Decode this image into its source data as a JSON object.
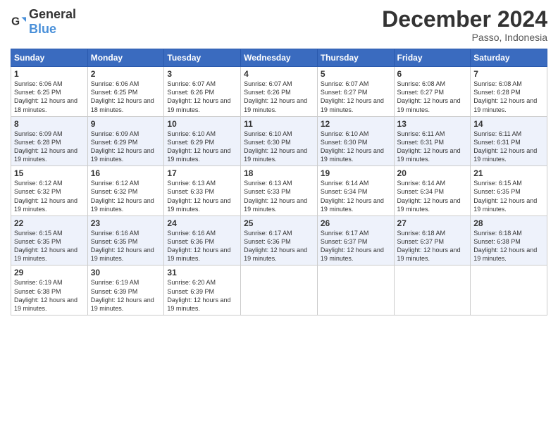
{
  "logo": {
    "general": "General",
    "blue": "Blue"
  },
  "header": {
    "title": "December 2024",
    "subtitle": "Passo, Indonesia"
  },
  "weekdays": [
    "Sunday",
    "Monday",
    "Tuesday",
    "Wednesday",
    "Thursday",
    "Friday",
    "Saturday"
  ],
  "weeks": [
    [
      {
        "day": "1",
        "sunrise": "6:06 AM",
        "sunset": "6:25 PM",
        "daylight": "12 hours and 18 minutes."
      },
      {
        "day": "2",
        "sunrise": "6:06 AM",
        "sunset": "6:25 PM",
        "daylight": "12 hours and 18 minutes."
      },
      {
        "day": "3",
        "sunrise": "6:07 AM",
        "sunset": "6:26 PM",
        "daylight": "12 hours and 19 minutes."
      },
      {
        "day": "4",
        "sunrise": "6:07 AM",
        "sunset": "6:26 PM",
        "daylight": "12 hours and 19 minutes."
      },
      {
        "day": "5",
        "sunrise": "6:07 AM",
        "sunset": "6:27 PM",
        "daylight": "12 hours and 19 minutes."
      },
      {
        "day": "6",
        "sunrise": "6:08 AM",
        "sunset": "6:27 PM",
        "daylight": "12 hours and 19 minutes."
      },
      {
        "day": "7",
        "sunrise": "6:08 AM",
        "sunset": "6:28 PM",
        "daylight": "12 hours and 19 minutes."
      }
    ],
    [
      {
        "day": "8",
        "sunrise": "6:09 AM",
        "sunset": "6:28 PM",
        "daylight": "12 hours and 19 minutes."
      },
      {
        "day": "9",
        "sunrise": "6:09 AM",
        "sunset": "6:29 PM",
        "daylight": "12 hours and 19 minutes."
      },
      {
        "day": "10",
        "sunrise": "6:10 AM",
        "sunset": "6:29 PM",
        "daylight": "12 hours and 19 minutes."
      },
      {
        "day": "11",
        "sunrise": "6:10 AM",
        "sunset": "6:30 PM",
        "daylight": "12 hours and 19 minutes."
      },
      {
        "day": "12",
        "sunrise": "6:10 AM",
        "sunset": "6:30 PM",
        "daylight": "12 hours and 19 minutes."
      },
      {
        "day": "13",
        "sunrise": "6:11 AM",
        "sunset": "6:31 PM",
        "daylight": "12 hours and 19 minutes."
      },
      {
        "day": "14",
        "sunrise": "6:11 AM",
        "sunset": "6:31 PM",
        "daylight": "12 hours and 19 minutes."
      }
    ],
    [
      {
        "day": "15",
        "sunrise": "6:12 AM",
        "sunset": "6:32 PM",
        "daylight": "12 hours and 19 minutes."
      },
      {
        "day": "16",
        "sunrise": "6:12 AM",
        "sunset": "6:32 PM",
        "daylight": "12 hours and 19 minutes."
      },
      {
        "day": "17",
        "sunrise": "6:13 AM",
        "sunset": "6:33 PM",
        "daylight": "12 hours and 19 minutes."
      },
      {
        "day": "18",
        "sunrise": "6:13 AM",
        "sunset": "6:33 PM",
        "daylight": "12 hours and 19 minutes."
      },
      {
        "day": "19",
        "sunrise": "6:14 AM",
        "sunset": "6:34 PM",
        "daylight": "12 hours and 19 minutes."
      },
      {
        "day": "20",
        "sunrise": "6:14 AM",
        "sunset": "6:34 PM",
        "daylight": "12 hours and 19 minutes."
      },
      {
        "day": "21",
        "sunrise": "6:15 AM",
        "sunset": "6:35 PM",
        "daylight": "12 hours and 19 minutes."
      }
    ],
    [
      {
        "day": "22",
        "sunrise": "6:15 AM",
        "sunset": "6:35 PM",
        "daylight": "12 hours and 19 minutes."
      },
      {
        "day": "23",
        "sunrise": "6:16 AM",
        "sunset": "6:35 PM",
        "daylight": "12 hours and 19 minutes."
      },
      {
        "day": "24",
        "sunrise": "6:16 AM",
        "sunset": "6:36 PM",
        "daylight": "12 hours and 19 minutes."
      },
      {
        "day": "25",
        "sunrise": "6:17 AM",
        "sunset": "6:36 PM",
        "daylight": "12 hours and 19 minutes."
      },
      {
        "day": "26",
        "sunrise": "6:17 AM",
        "sunset": "6:37 PM",
        "daylight": "12 hours and 19 minutes."
      },
      {
        "day": "27",
        "sunrise": "6:18 AM",
        "sunset": "6:37 PM",
        "daylight": "12 hours and 19 minutes."
      },
      {
        "day": "28",
        "sunrise": "6:18 AM",
        "sunset": "6:38 PM",
        "daylight": "12 hours and 19 minutes."
      }
    ],
    [
      {
        "day": "29",
        "sunrise": "6:19 AM",
        "sunset": "6:38 PM",
        "daylight": "12 hours and 19 minutes."
      },
      {
        "day": "30",
        "sunrise": "6:19 AM",
        "sunset": "6:39 PM",
        "daylight": "12 hours and 19 minutes."
      },
      {
        "day": "31",
        "sunrise": "6:20 AM",
        "sunset": "6:39 PM",
        "daylight": "12 hours and 19 minutes."
      },
      null,
      null,
      null,
      null
    ]
  ]
}
